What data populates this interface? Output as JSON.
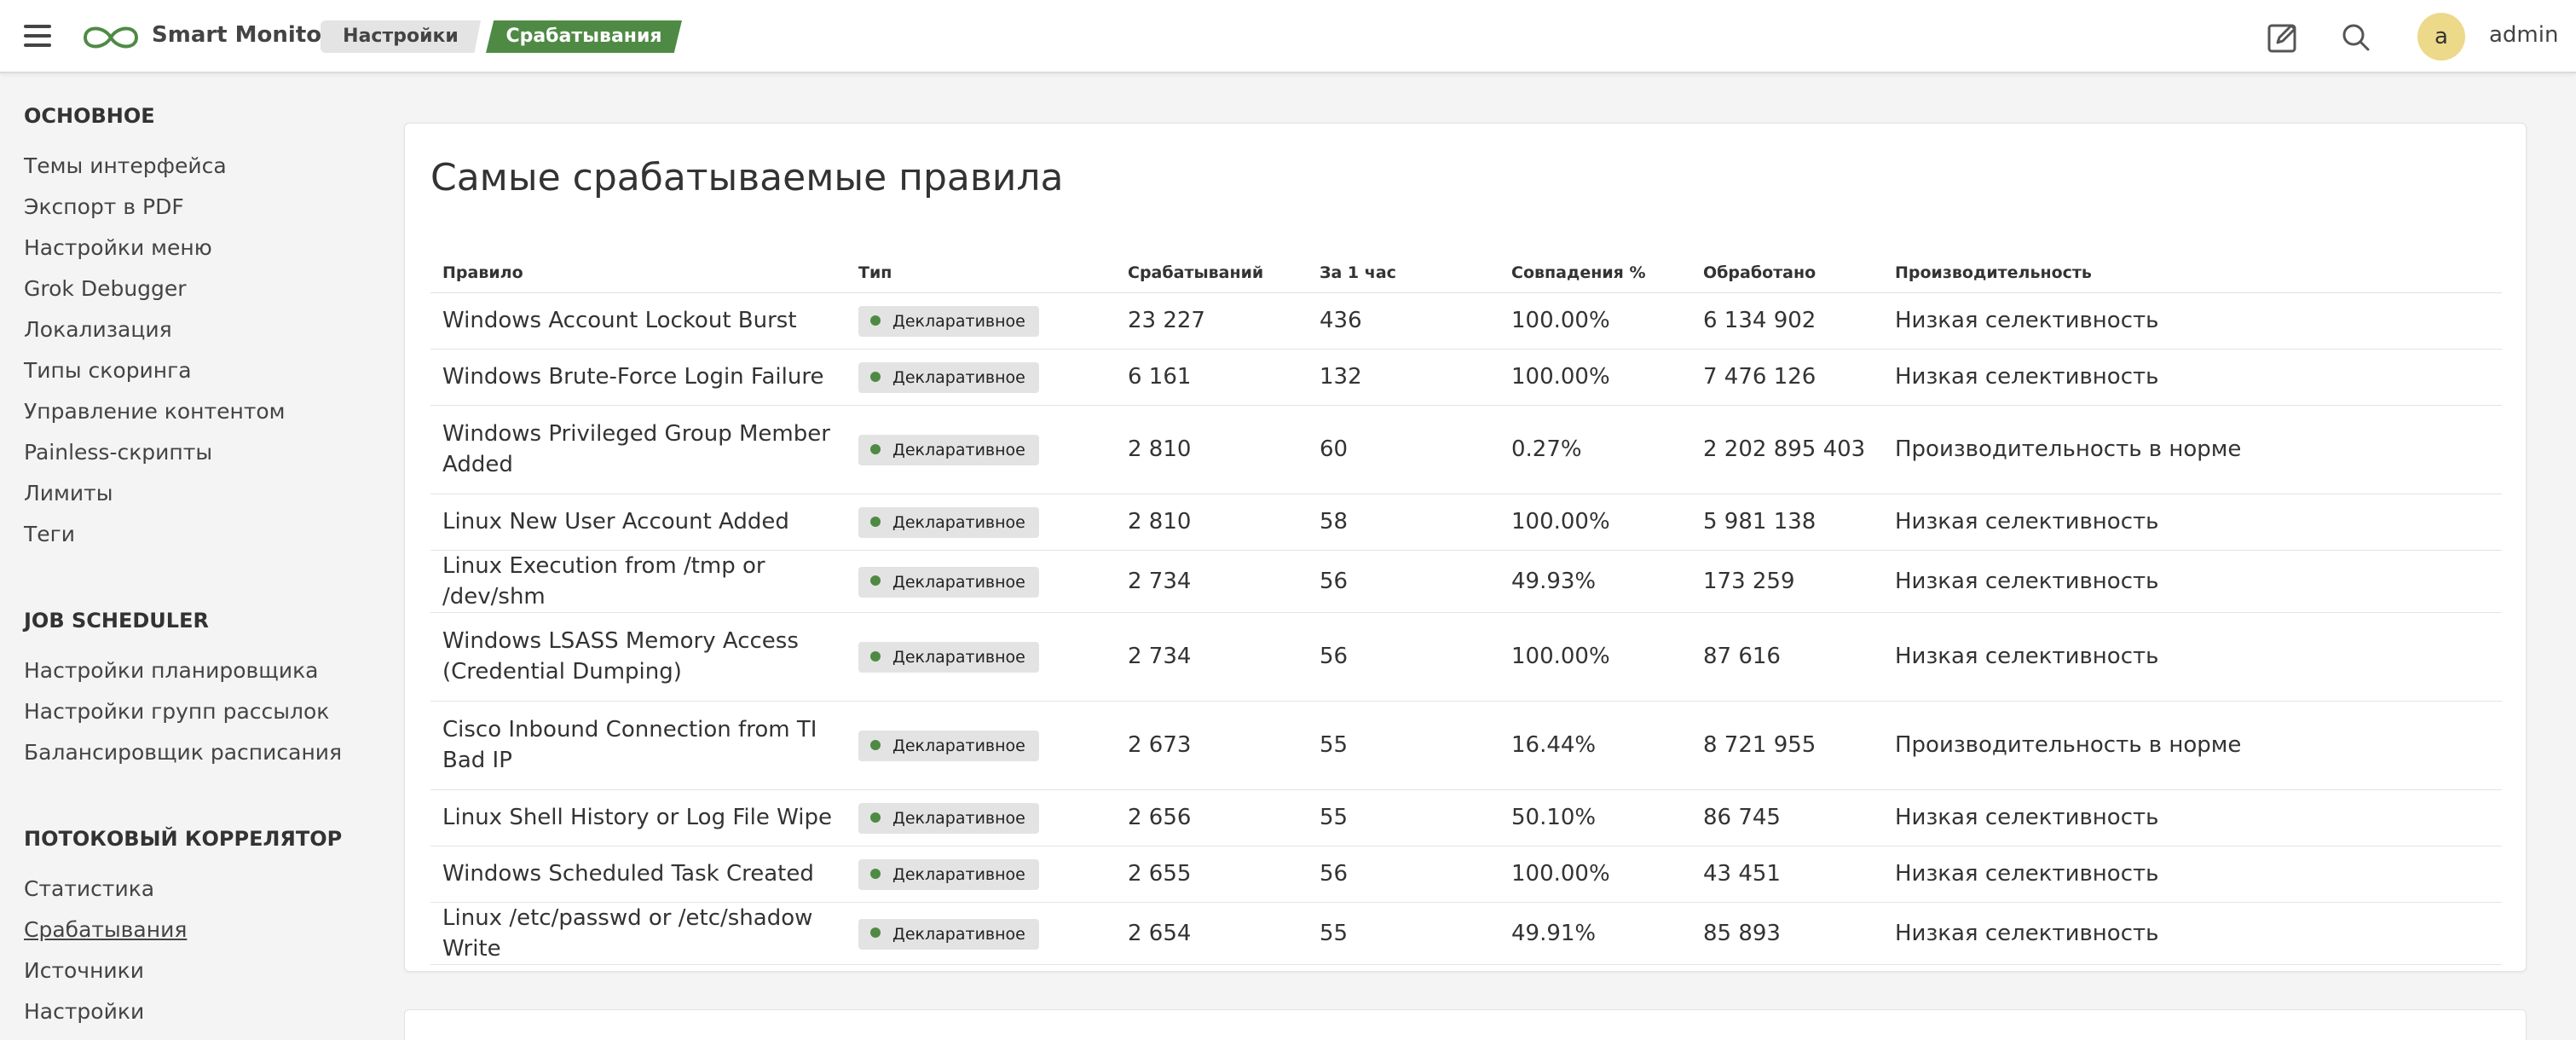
{
  "header": {
    "app_name": "Smart Monitor",
    "breadcrumbs": [
      "Настройки",
      "Срабатывания"
    ],
    "avatar_letter": "a",
    "username": "admin",
    "accent_color": "#4f8a45"
  },
  "sidebar": {
    "sections": [
      {
        "title": "ОСНОВНОЕ",
        "items": [
          "Темы интерфейса",
          "Экспорт в PDF",
          "Настройки меню",
          "Grok Debugger",
          "Локализация",
          "Типы скоринга",
          "Управление контентом",
          "Painless-скрипты",
          "Лимиты",
          "Теги"
        ]
      },
      {
        "title": "JOB SCHEDULER",
        "items": [
          "Настройки планировщика",
          "Настройки групп рассылок",
          "Балансировщик расписания"
        ]
      },
      {
        "title": "ПОТОКОВЫЙ КОРРЕЛЯТОР",
        "items": [
          "Статистика",
          "Срабатывания",
          "Источники",
          "Настройки"
        ]
      }
    ],
    "active_item": "Срабатывания"
  },
  "main": {
    "title": "Самые срабатываемые правила",
    "columns": [
      "Правило",
      "Тип",
      "Срабатываний",
      "За 1 час",
      "Совпадения %",
      "Обработано",
      "Производительность"
    ],
    "rows": [
      {
        "rule": "Windows Account Lockout Burst",
        "type": "Декларативное",
        "hits": "23 227",
        "per_hour": "436",
        "match": "100.00%",
        "processed": "6 134 902",
        "perf": "Низкая селективность"
      },
      {
        "rule": "Windows Brute-Force Login Failure",
        "type": "Декларативное",
        "hits": "6 161",
        "per_hour": "132",
        "match": "100.00%",
        "processed": "7 476 126",
        "perf": "Низкая селективность"
      },
      {
        "rule": "Windows Privileged Group Member Added",
        "type": "Декларативное",
        "hits": "2 810",
        "per_hour": "60",
        "match": "0.27%",
        "processed": "2 202 895 403",
        "perf": "Производительность в норме"
      },
      {
        "rule": "Linux New User Account Added",
        "type": "Декларативное",
        "hits": "2 810",
        "per_hour": "58",
        "match": "100.00%",
        "processed": "5 981 138",
        "perf": "Низкая селективность"
      },
      {
        "rule": "Linux Execution from /tmp or /dev/shm",
        "type": "Декларативное",
        "hits": "2 734",
        "per_hour": "56",
        "match": "49.93%",
        "processed": "173 259",
        "perf": "Низкая селективность"
      },
      {
        "rule": "Windows LSASS Memory Access (Credential Dumping)",
        "type": "Декларативное",
        "hits": "2 734",
        "per_hour": "56",
        "match": "100.00%",
        "processed": "87 616",
        "perf": "Низкая селективность"
      },
      {
        "rule": "Cisco Inbound Connection from TI Bad IP",
        "type": "Декларативное",
        "hits": "2 673",
        "per_hour": "55",
        "match": "16.44%",
        "processed": "8 721 955",
        "perf": "Производительность в норме"
      },
      {
        "rule": "Linux Shell History or Log File Wipe",
        "type": "Декларативное",
        "hits": "2 656",
        "per_hour": "55",
        "match": "50.10%",
        "processed": "86 745",
        "perf": "Низкая селективность"
      },
      {
        "rule": "Windows Scheduled Task Created",
        "type": "Декларативное",
        "hits": "2 655",
        "per_hour": "56",
        "match": "100.00%",
        "processed": "43 451",
        "perf": "Низкая селективность"
      },
      {
        "rule": "Linux /etc/passwd or /etc/shadow Write",
        "type": "Декларативное",
        "hits": "2 654",
        "per_hour": "55",
        "match": "49.91%",
        "processed": "85 893",
        "perf": "Низкая селективность"
      }
    ]
  }
}
